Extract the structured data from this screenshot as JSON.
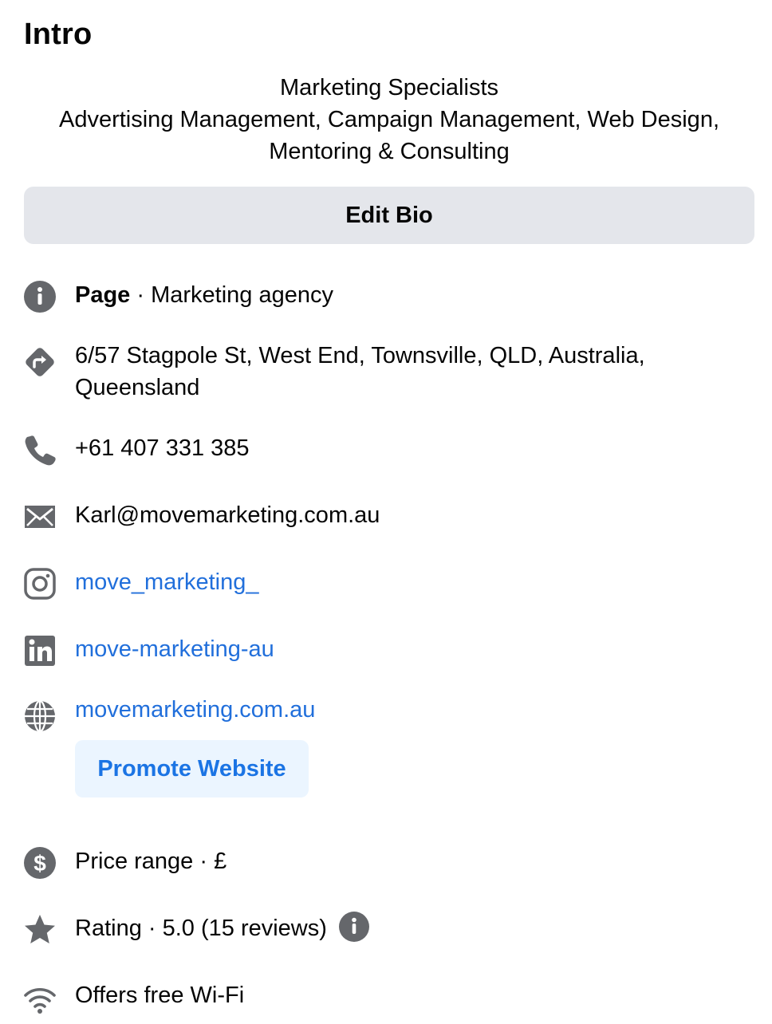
{
  "section": {
    "title": "Intro"
  },
  "bio": {
    "line1": "Marketing Specialists",
    "line2": "Advertising Management, Campaign Management, Web Design,",
    "line3": "Mentoring & Consulting"
  },
  "edit_bio_label": "Edit Bio",
  "details": {
    "category_label": "Page",
    "category_value": " · Marketing agency",
    "address_line1": "6/57 Stagpole St, West End, Townsville, QLD, Australia,",
    "address_line2": "Queensland",
    "phone": "+61 407 331 385",
    "email": "Karl@movemarketing.com.au",
    "instagram": "move_marketing_",
    "linkedin": "move-marketing-au",
    "website": "movemarketing.com.au",
    "promote_label": "Promote Website",
    "price_range": "Price range · £",
    "rating": "Rating · 5.0 (15 reviews)",
    "wifi": "Offers free Wi-Fi"
  },
  "icons": {
    "info": "info-icon",
    "directions": "directions-icon",
    "phone": "phone-icon",
    "email": "email-icon",
    "instagram": "instagram-icon",
    "linkedin": "linkedin-icon",
    "globe": "globe-icon",
    "price": "dollar-icon",
    "rating": "star-icon",
    "wifi": "wifi-icon"
  },
  "colors": {
    "icon_gray": "#65676b",
    "link_blue": "#216fdb",
    "button_gray": "#e4e6eb",
    "promote_bg": "#ebf5ff"
  }
}
